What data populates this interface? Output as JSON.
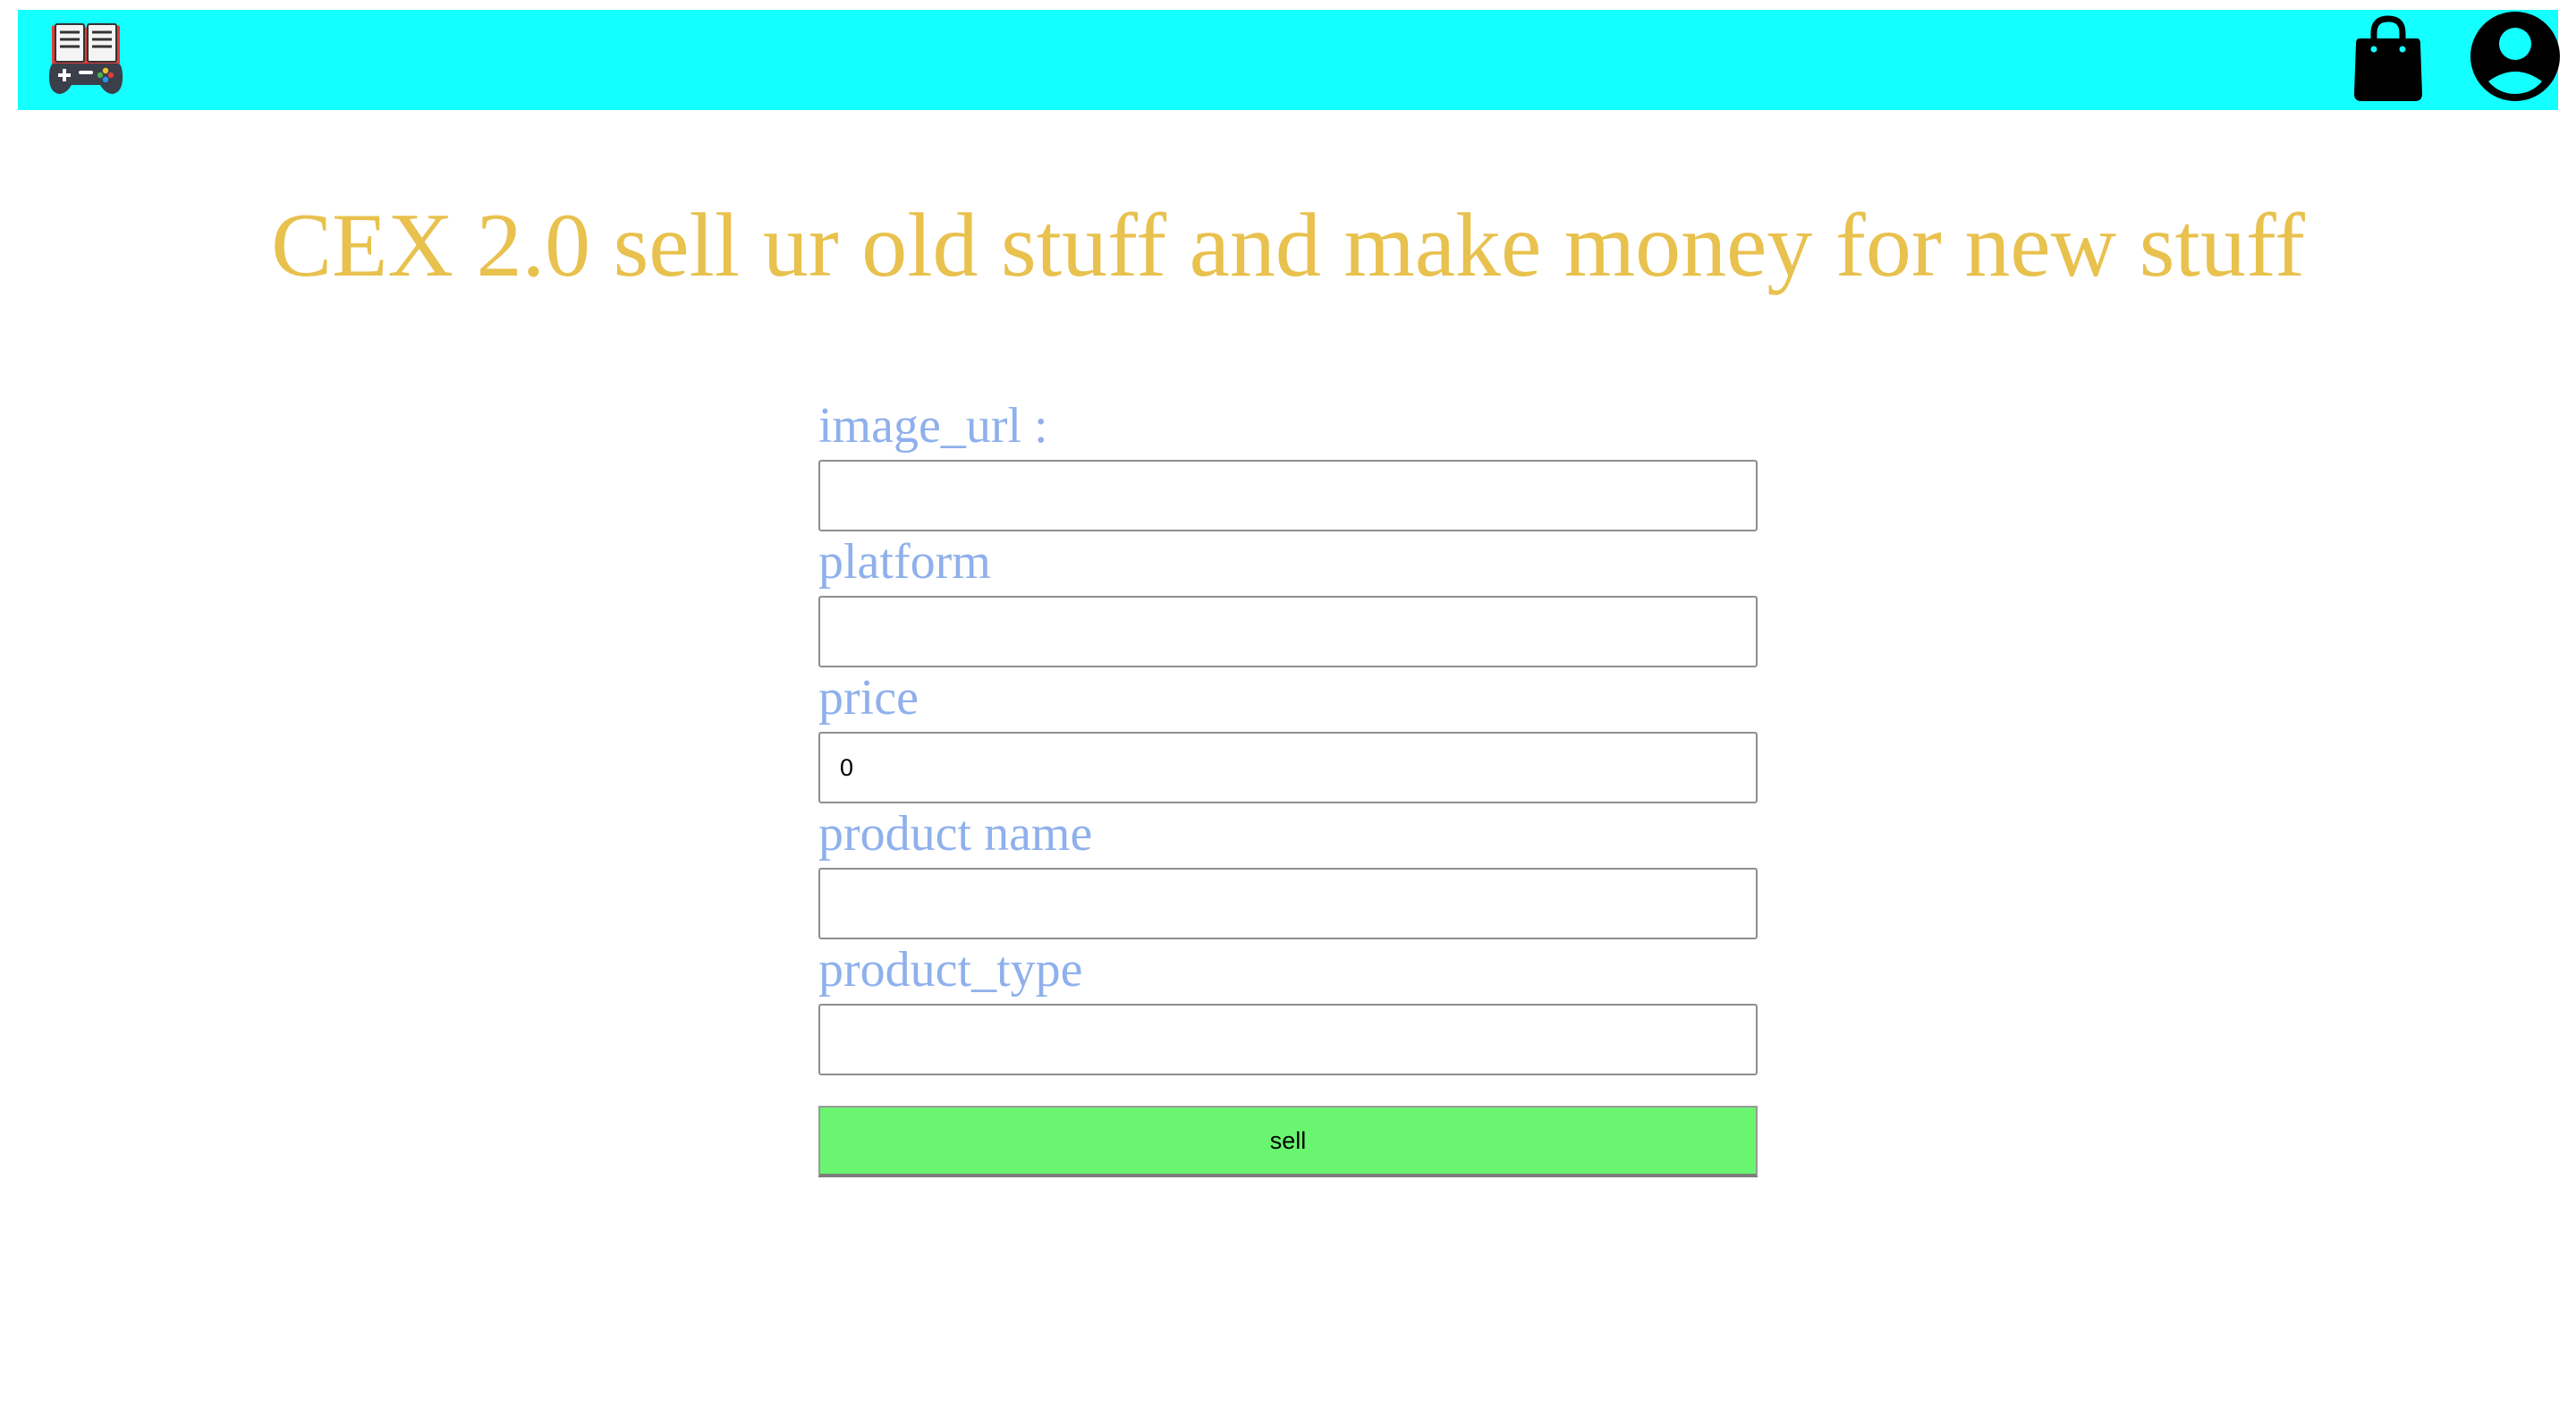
{
  "navbar": {
    "background": "#14ffff",
    "logo_icon": "book-gamepad-logo",
    "bag_icon": "shopping-bag-icon",
    "user_icon": "user-account-icon"
  },
  "page": {
    "title": "CEX 2.0 sell ur old stuff and make money for new stuff",
    "title_color": "#e8c14e",
    "label_color": "#8fb0ec"
  },
  "form": {
    "fields": [
      {
        "label": "image_url :",
        "value": ""
      },
      {
        "label": "platform",
        "value": ""
      },
      {
        "label": "price",
        "value": "0"
      },
      {
        "label": "product name",
        "value": ""
      },
      {
        "label": "product_type",
        "value": ""
      }
    ],
    "submit_label": "sell",
    "submit_color": "#69f56f"
  }
}
